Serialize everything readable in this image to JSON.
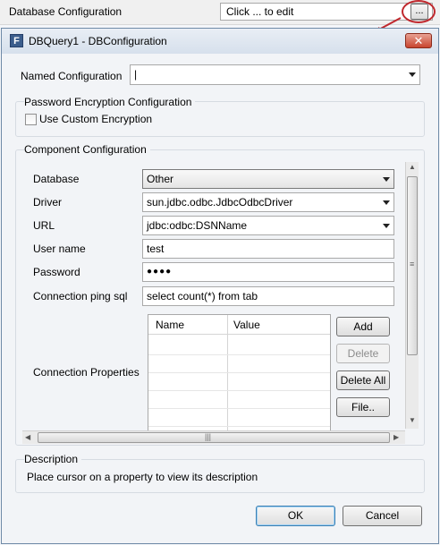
{
  "property_strip": {
    "label": "Database Configuration",
    "value": "Click ... to edit",
    "ellipsis_label": "..."
  },
  "dialog": {
    "icon_letter": "F",
    "title": "DBQuery1 - DBConfiguration",
    "close_label": "✕",
    "named_configuration": {
      "label": "Named Configuration",
      "value": "|"
    },
    "password_encryption": {
      "title": "Password Encryption Configuration",
      "checkbox_label": "Use Custom Encryption",
      "checked": false
    },
    "component_configuration": {
      "title": "Component Configuration",
      "fields": {
        "database_label": "Database",
        "database_value": "Other",
        "driver_label": "Driver",
        "driver_value": "sun.jdbc.odbc.JdbcOdbcDriver",
        "url_label": "URL",
        "url_value": "jdbc:odbc:DSNName",
        "username_label": "User name",
        "username_value": "test",
        "password_label": "Password",
        "password_value": "●●●●",
        "ping_label": "Connection ping sql",
        "ping_value": "select count(*) from tab"
      },
      "connection_properties": {
        "label": "Connection Properties",
        "columns": [
          "Name",
          "Value"
        ],
        "rows": [],
        "buttons": {
          "add": "Add",
          "delete": "Delete",
          "delete_all": "Delete All",
          "file": "File.."
        }
      },
      "hscroll_grip": "|||",
      "vscroll_grip": "≡"
    },
    "description": {
      "title": "Description",
      "text": "Place cursor on a property to view its description"
    },
    "ok_label": "OK",
    "cancel_label": "Cancel"
  },
  "colors": {
    "annotation": "#c0282d",
    "title_bar": "#d6e0ec",
    "close": "#c8452f"
  }
}
